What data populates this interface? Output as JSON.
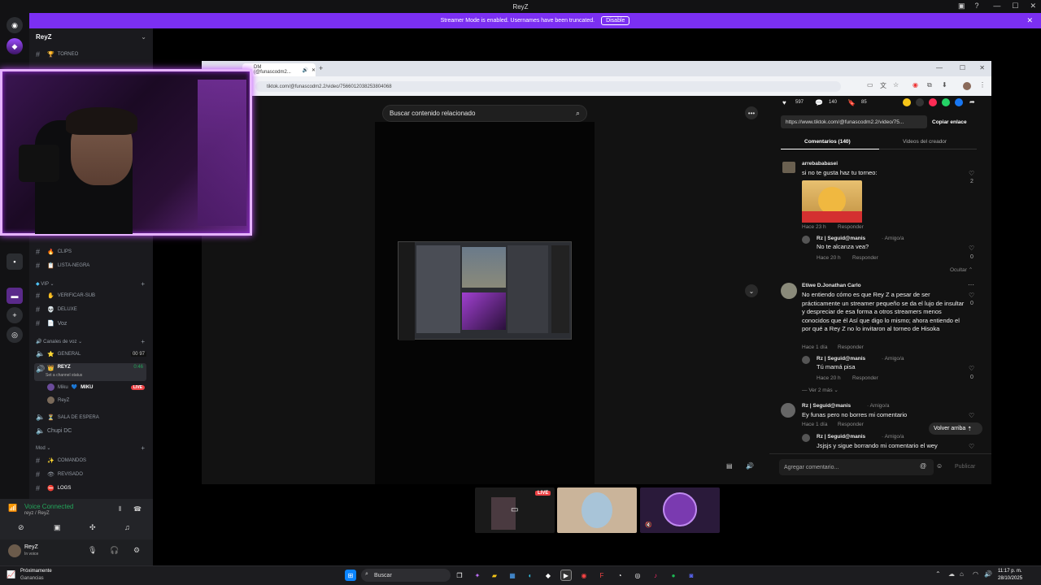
{
  "window": {
    "title": "ReyZ"
  },
  "banner": {
    "text": "Streamer Mode is enabled. Usernames have been truncated.",
    "button": "Disable"
  },
  "server": {
    "name": "ReyZ"
  },
  "channels": [
    {
      "name": "TORNEO",
      "type": "text"
    },
    {
      "name": "CLIPS",
      "type": "text"
    },
    {
      "name": "LISTA-NEGRA",
      "type": "text"
    }
  ],
  "categories": {
    "vip": "VIP",
    "voice": "Canales de voz",
    "mod": "Mod"
  },
  "vip_channels": [
    {
      "name": "VERIFICAR-SUB"
    },
    {
      "name": "DELUXE"
    },
    {
      "name": "Voz"
    }
  ],
  "voice_channels": {
    "general": {
      "name": "GENERAL",
      "count_a": "00",
      "count_b": "97"
    },
    "reyz": {
      "name": "REYZ",
      "timer": "0:46",
      "status": "Set a channel status"
    },
    "members": [
      {
        "name": "Miku",
        "tag": "MIKU",
        "live": "LIVE"
      },
      {
        "name": "ReyZ"
      }
    ],
    "espera": "SALA DE ESPERA",
    "chupi": "Chupi DC"
  },
  "mod_channels": [
    {
      "name": "COMANDOS"
    },
    {
      "name": "REVISADO"
    },
    {
      "name": "LOGS"
    }
  ],
  "voice_panel": {
    "status": "Voice Connected",
    "sub": "reyz / ReyZ"
  },
  "user_panel": {
    "name": "ReyZ",
    "status": "In voice"
  },
  "browser": {
    "tab_title": "DM (@funascodm2...",
    "url": "tiktok.com/@funascodm2.2/video/7566012038253804068",
    "search_placeholder": "Buscar contenido relacionado"
  },
  "tiktok": {
    "stats": {
      "likes": "597",
      "comments": "140",
      "saves": "85"
    },
    "link": "https://www.tiktok.com/@funascodm2.2/video/75...",
    "copy_link": "Copiar enlace",
    "tab_comments": "Comentarios (140)",
    "tab_creator": "Videos del creador",
    "comments": [
      {
        "user": "arrebababasei",
        "text": "si no te gusta haz tu torneo:",
        "meta": "Hace 23 h",
        "reply": "Responder",
        "likes": "2"
      },
      {
        "user": "Rz | Seguid@manis",
        "badge": "· Amigo/a",
        "text": "No te alcanza vea?",
        "meta": "Hace 20 h",
        "reply": "Responder",
        "likes": "0"
      },
      {
        "user": "Etiwe D.Jonathan Carlo",
        "text": "No entiendo cómo es que Rey Z a pesar de ser prácticamente un streamer pequeño se da el lujo de insultar y despreciar de esa forma a otros streamers menos conocidos que él Así que digo lo mismo; ahora entiendo el por qué a Rey Z no lo invitaron al torneo de Hisoka",
        "meta": "Hace 1 día",
        "reply": "Responder",
        "likes": "0"
      },
      {
        "user": "Rz | Seguid@manis",
        "badge": "· Amigo/a",
        "text": "Tú mamá pisa",
        "meta": "Hace 20 h",
        "reply": "Responder",
        "likes": "0"
      },
      {
        "user": "Rz | Seguid@manis",
        "badge": "· Amigo/a",
        "text": "Ey funas pero no borres mi comentario",
        "meta": "Hace 1 día",
        "reply": "Responder",
        "likes": ""
      },
      {
        "user": "Rz | Seguid@manis",
        "badge": "· Amigo/a",
        "text": "Jsjsjs y sigue borrando mi comentario el wey",
        "meta": "",
        "reply": "",
        "likes": ""
      }
    ],
    "hide": "Ocultar",
    "more": "Ver 2 más",
    "back_top": "Volver arriba",
    "add_comment": "Agregar comentario...",
    "publish": "Publicar"
  },
  "stream_tiles": {
    "live": "LIVE"
  },
  "taskbar": {
    "weather_title": "Próximamente",
    "weather_sub": "Ganancias",
    "search": "Buscar",
    "time": "11:17 p. m.",
    "date": "28/10/2025"
  },
  "colors": {
    "accent": "#7b2ff2",
    "live": "#ed4245",
    "voice_green": "#23a55a"
  }
}
